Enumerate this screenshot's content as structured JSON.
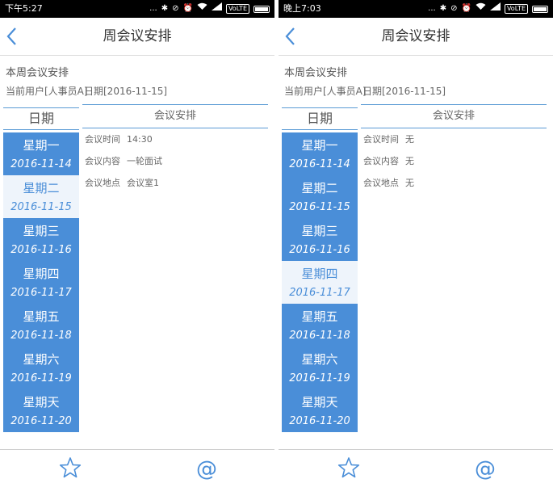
{
  "screens": [
    {
      "status": {
        "time": "下午5:27",
        "icons": [
          "...",
          "bluetooth-icon",
          "mute-icon",
          "alarm-icon",
          "wifi-icon",
          "signal-icon"
        ],
        "volte": "VoLTE"
      },
      "header": {
        "title": "周会议安排",
        "back_icon": "chevron-left-icon"
      },
      "section_title": "本周会议安排",
      "current_user": "当前用户[人事员A]",
      "current_date": "日期[2016-11-15]",
      "date_column_header": "日期",
      "meeting_column_header": "会议安排",
      "days": [
        {
          "weekday": "星期一",
          "date": "2016-11-14",
          "selected": false
        },
        {
          "weekday": "星期二",
          "date": "2016-11-15",
          "selected": true
        },
        {
          "weekday": "星期三",
          "date": "2016-11-16",
          "selected": false
        },
        {
          "weekday": "星期四",
          "date": "2016-11-17",
          "selected": false
        },
        {
          "weekday": "星期五",
          "date": "2016-11-18",
          "selected": false
        },
        {
          "weekday": "星期六",
          "date": "2016-11-19",
          "selected": false
        },
        {
          "weekday": "星期天",
          "date": "2016-11-20",
          "selected": false
        }
      ],
      "details": [
        {
          "label": "会议时间",
          "value": "14:30"
        },
        {
          "label": "会议内容",
          "value": "一轮面试"
        },
        {
          "label": "会议地点",
          "value": "会议室1"
        }
      ],
      "tabs": [
        {
          "icon": "star-icon"
        },
        {
          "icon": "at-icon",
          "glyph": "@"
        }
      ]
    },
    {
      "status": {
        "time": "晚上7:03",
        "icons": [
          "...",
          "bluetooth-icon",
          "mute-icon",
          "alarm-icon",
          "wifi-icon",
          "signal-icon"
        ],
        "volte": "VoLTE"
      },
      "header": {
        "title": "周会议安排",
        "back_icon": "chevron-left-icon"
      },
      "section_title": "本周会议安排",
      "current_user": "当前用户[人事员A]",
      "current_date": "日期[2016-11-15]",
      "date_column_header": "日期",
      "meeting_column_header": "会议安排",
      "days": [
        {
          "weekday": "星期一",
          "date": "2016-11-14",
          "selected": false
        },
        {
          "weekday": "星期二",
          "date": "2016-11-15",
          "selected": false
        },
        {
          "weekday": "星期三",
          "date": "2016-11-16",
          "selected": false
        },
        {
          "weekday": "星期四",
          "date": "2016-11-17",
          "selected": true
        },
        {
          "weekday": "星期五",
          "date": "2016-11-18",
          "selected": false
        },
        {
          "weekday": "星期六",
          "date": "2016-11-19",
          "selected": false
        },
        {
          "weekday": "星期天",
          "date": "2016-11-20",
          "selected": false
        }
      ],
      "details": [
        {
          "label": "会议时间",
          "value": "无"
        },
        {
          "label": "会议内容",
          "value": "无"
        },
        {
          "label": "会议地点",
          "value": "无"
        }
      ],
      "tabs": [
        {
          "icon": "star-icon"
        },
        {
          "icon": "at-icon",
          "glyph": "@"
        }
      ]
    }
  ],
  "colors": {
    "accent": "#4a8ed8",
    "selected_bg": "#eef4fb",
    "status_bar": "#000000"
  }
}
